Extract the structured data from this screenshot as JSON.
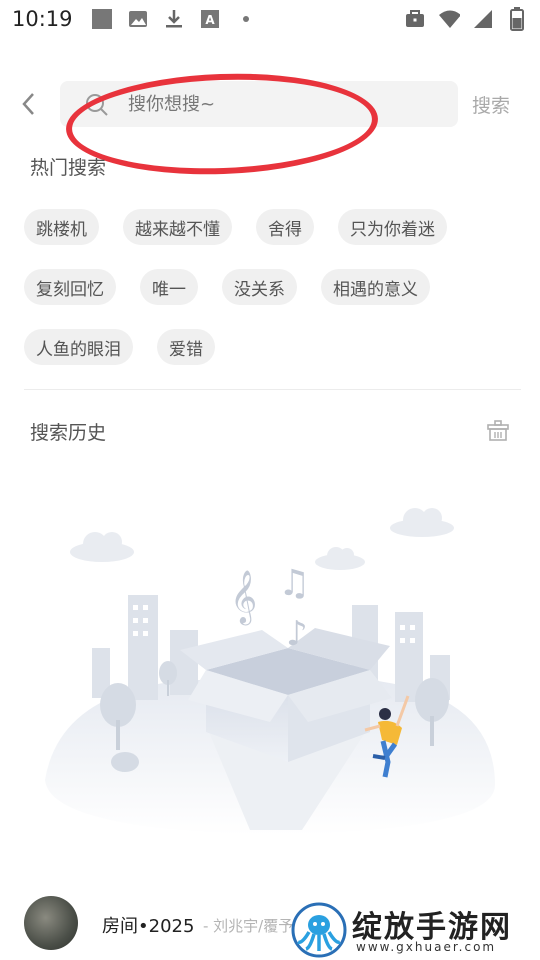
{
  "status_bar": {
    "time": "10:19",
    "icons_left": [
      "square-notification-icon",
      "image-icon",
      "download-icon",
      "text-a-icon",
      "dot-icon"
    ],
    "icons_right": [
      "briefcase-icon",
      "wifi-icon",
      "signal-icon",
      "battery-icon"
    ]
  },
  "search": {
    "placeholder": "搜你想搜~",
    "button_label": "搜索"
  },
  "hot_search": {
    "title": "热门搜索",
    "rows": [
      [
        "跳楼机",
        "越来越不懂",
        "舍得",
        "只为你着迷"
      ],
      [
        "复刻回忆",
        "唯一",
        "没关系",
        "相遇的意义"
      ],
      [
        "人鱼的眼泪",
        "爱错"
      ]
    ]
  },
  "history": {
    "title": "搜索历史"
  },
  "player": {
    "song_title": "房间•2025",
    "artist": "- 刘兆宇/覆予"
  },
  "watermark": {
    "title": "绽放手游网",
    "url": "www.gxhuaer.com"
  },
  "colors": {
    "annotation": "#e8333c",
    "chip_bg": "#f0f0f0",
    "search_bg": "#f3f3f3"
  }
}
